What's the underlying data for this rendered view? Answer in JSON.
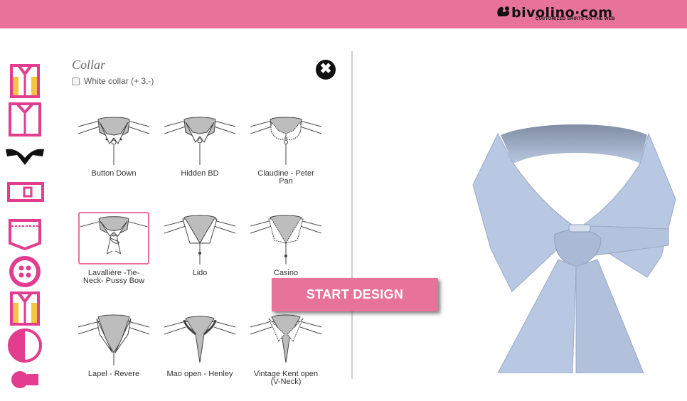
{
  "brand": {
    "name": "bivolino·com",
    "tagline": "CUSTOMIZED SHIRTS ON THE WEB",
    "bar_color": "#e8739a"
  },
  "sidebar": {
    "items": [
      {
        "name": "shirt-body-icon"
      },
      {
        "name": "shirt-front-icon"
      },
      {
        "name": "collar-icon"
      },
      {
        "name": "cuff-icon"
      },
      {
        "name": "pocket-icon"
      },
      {
        "name": "button-icon"
      },
      {
        "name": "contrast-shirt-icon"
      },
      {
        "name": "half-contrast-icon"
      },
      {
        "name": "monogram-icon"
      }
    ]
  },
  "panel": {
    "title": "Collar",
    "white_collar_label": "White collar (+ 3,-)",
    "close_glyph": "✖"
  },
  "collars": [
    {
      "label": "Button Down",
      "selected": false
    },
    {
      "label": "Hidden BD",
      "selected": false
    },
    {
      "label": "Claudine - Peter Pan",
      "selected": false
    },
    {
      "label": "Lavallière -Tie-Neck- Pussy Bow",
      "selected": true
    },
    {
      "label": "Lido",
      "selected": false
    },
    {
      "label": "Casino",
      "selected": false
    },
    {
      "label": "Lapel - Revere",
      "selected": false
    },
    {
      "label": "Mao open - Henley",
      "selected": false
    },
    {
      "label": "Vintage Kent open (V-Neck)",
      "selected": false
    }
  ],
  "cta": {
    "label": "START DESIGN"
  },
  "colors": {
    "accent": "#e8739a",
    "shirt_blue": "#b9c8e2"
  }
}
